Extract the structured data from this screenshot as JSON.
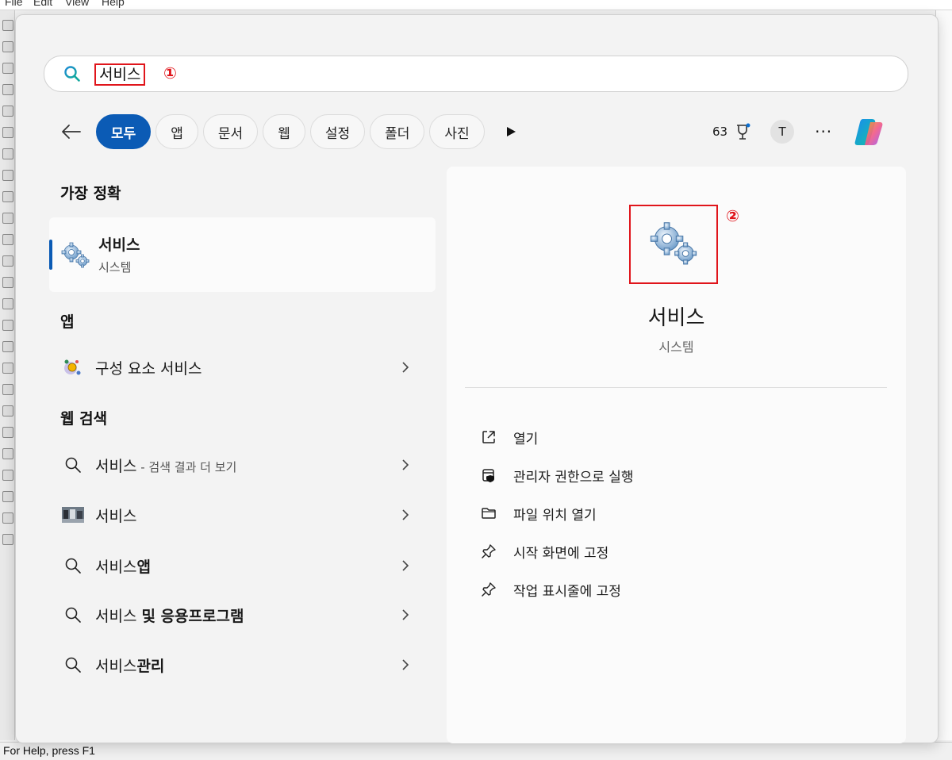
{
  "background_app": {
    "menu": [
      "File",
      "Edit",
      "View",
      "Help"
    ],
    "status_text": "For Help, press F1"
  },
  "search": {
    "query": "서비스",
    "annotation_1": "①",
    "annotation_2": "②"
  },
  "filters": {
    "chips": [
      "모두",
      "앱",
      "문서",
      "웹",
      "설정",
      "폴더",
      "사진"
    ],
    "active": "모두",
    "points": "63",
    "avatar_letter": "T",
    "more": "···"
  },
  "results": {
    "best_match_title": "가장 정확",
    "best_match": {
      "name": "서비스",
      "type": "시스템"
    },
    "apps_title": "앱",
    "apps": [
      {
        "name": "구성 요소 서비스"
      }
    ],
    "web_title": "웹 검색",
    "web": [
      {
        "name": "서비스",
        "suffix": " - 검색 결과 더 보기",
        "icon": "search-icon"
      },
      {
        "name": "서비스",
        "suffix": "",
        "icon": "image-thumbnail-icon"
      },
      {
        "prefix": "서비스",
        "bold": "앱",
        "icon": "search-icon"
      },
      {
        "prefix": "서비스 ",
        "bold": "및 응용프로그램",
        "icon": "search-icon"
      },
      {
        "prefix": "서비스",
        "bold": "관리",
        "icon": "search-icon"
      }
    ]
  },
  "detail": {
    "title": "서비스",
    "subtitle": "시스템",
    "actions": [
      {
        "label": "열기",
        "icon": "open-external-icon"
      },
      {
        "label": "관리자 권한으로 실행",
        "icon": "admin-shield-icon"
      },
      {
        "label": "파일 위치 열기",
        "icon": "folder-icon"
      },
      {
        "label": "시작 화면에 고정",
        "icon": "pin-icon"
      },
      {
        "label": "작업 표시줄에 고정",
        "icon": "pin-icon"
      }
    ]
  },
  "colors": {
    "accent": "#0b5bb5",
    "annotation": "#e0151b"
  }
}
